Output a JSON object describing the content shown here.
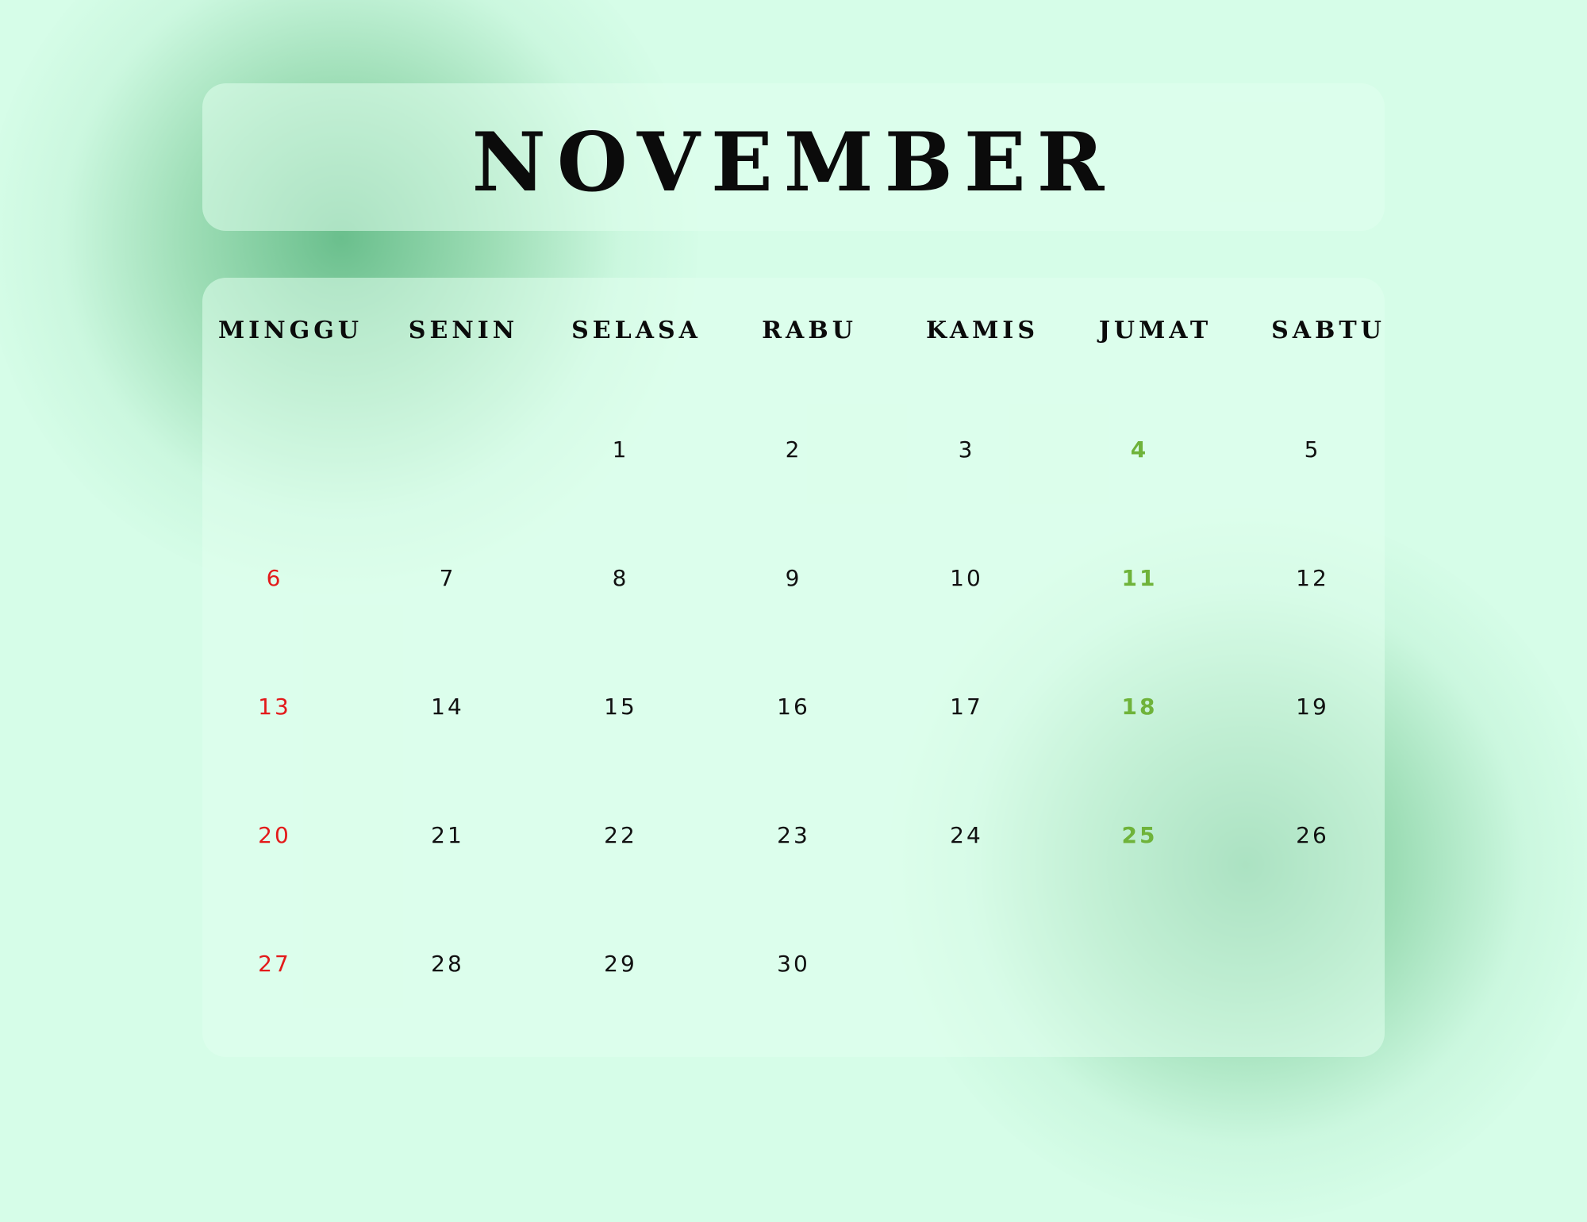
{
  "month": "NOVEMBER",
  "weekdays": [
    "MINGGU",
    "SENIN",
    "SELASA",
    "RABU",
    "KAMIS",
    "JUMAT",
    "SABTU"
  ],
  "weeks": [
    [
      "",
      "",
      "1",
      "2",
      "3",
      "4",
      "5"
    ],
    [
      "6",
      "7",
      "8",
      "9",
      "10",
      "11",
      "12"
    ],
    [
      "13",
      "14",
      "15",
      "16",
      "17",
      "18",
      "19"
    ],
    [
      "20",
      "21",
      "22",
      "23",
      "24",
      "25",
      "26"
    ],
    [
      "27",
      "28",
      "29",
      "30",
      "",
      "",
      ""
    ]
  ],
  "colors": {
    "background": "#d6fde8",
    "sunday": "#e31a1a",
    "friday": "#6fb33a",
    "text": "#0b0b0b"
  }
}
